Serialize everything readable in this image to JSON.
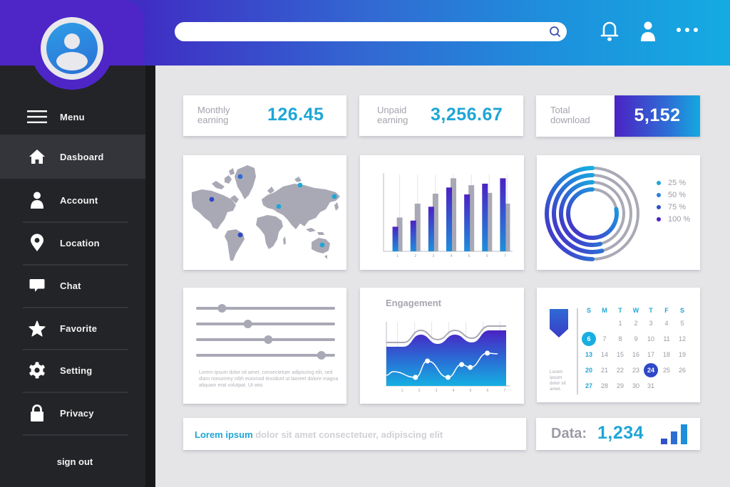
{
  "header": {
    "search": {
      "placeholder": "",
      "value": ""
    },
    "icons": [
      "bell-icon",
      "user-icon",
      "more-icon"
    ]
  },
  "sidebar": {
    "items": [
      {
        "label": "Menu",
        "icon": "menu-icon",
        "active": false
      },
      {
        "label": "Dasboard",
        "icon": "home-icon",
        "active": true
      },
      {
        "label": "Account",
        "icon": "user-icon",
        "active": false
      },
      {
        "label": "Location",
        "icon": "location-pin-icon",
        "active": false
      },
      {
        "label": "Chat",
        "icon": "chat-icon",
        "active": false
      },
      {
        "label": "Favorite",
        "icon": "star-icon",
        "active": false
      },
      {
        "label": "Setting",
        "icon": "gear-icon",
        "active": false
      },
      {
        "label": "Privacy",
        "icon": "lock-icon",
        "active": false
      }
    ],
    "sign_out": "sign out"
  },
  "stats": {
    "monthly": {
      "label_line1": "Monthly",
      "label_line2": "earning",
      "value": "126.45"
    },
    "unpaid": {
      "label_line1": "Unpaid",
      "label_line2": "earning",
      "value": "3,256.67"
    },
    "download": {
      "label_line1": "Total",
      "label_line2": "download",
      "value": "5,152"
    }
  },
  "sliders": {
    "values": [
      0.18,
      0.37,
      0.52,
      0.91
    ],
    "text": "Lorem ipsum dolor sit amet, consectetuer adipiscing elit, sed diam nonummy nibh euismod tincidunt ut laoreet dolore magna aliquam erat volutpat. Ut wisi"
  },
  "calendar": {
    "weekdays": [
      "S",
      "M",
      "T",
      "W",
      "T",
      "F",
      "S"
    ],
    "first_weekday_index": 2,
    "days_in_month": 31,
    "highlight_light": 6,
    "highlight_dark": 24,
    "note": "Lorem ipsum dolor sit amet."
  },
  "footer": {
    "highlight": "Lorem ipsum",
    "text": " dolor sit amet consectetuer, adipiscing elit",
    "data_label": "Data:",
    "data_value": "1,234"
  },
  "colors": {
    "accent": "#1ea6d6",
    "purple": "#4b22c4",
    "blue": "#2f6ad5",
    "gray": "#a9a9b6",
    "sidebar_bg": "#232427"
  },
  "chart_data": [
    {
      "type": "map",
      "title": "",
      "markers": [
        {
          "region": "Greenland",
          "color": "#2e6ad6"
        },
        {
          "region": "North America",
          "color": "#2e48c8"
        },
        {
          "region": "South America",
          "color": "#2e48c8"
        },
        {
          "region": "Europe",
          "color": "#1ea6d6"
        },
        {
          "region": "Northern Russia",
          "color": "#1ea6d6"
        },
        {
          "region": "Eastern Russia",
          "color": "#1ea6d6"
        },
        {
          "region": "Australia",
          "color": "#1ea6d6"
        }
      ]
    },
    {
      "type": "bar",
      "title": "",
      "categories": [
        "1",
        "2",
        "3",
        "4",
        "5",
        "6",
        "7"
      ],
      "series": [
        {
          "name": "primary",
          "values": [
            3.2,
            4.0,
            5.8,
            8.3,
            7.4,
            8.8,
            9.5
          ]
        },
        {
          "name": "secondary",
          "values": [
            4.4,
            6.2,
            7.5,
            9.5,
            8.6,
            7.6,
            6.2
          ]
        }
      ],
      "ylim": [
        0,
        10
      ],
      "grid": true
    },
    {
      "type": "pie",
      "title": "",
      "rings": [
        {
          "label": "25 %",
          "value": 25,
          "color": "#1ea6d6"
        },
        {
          "label": "50 %",
          "value": 50,
          "color": "#2a80d8"
        },
        {
          "label": "75 %",
          "value": 75,
          "color": "#2e52c8"
        },
        {
          "label": "100 %",
          "value": 100,
          "color": "#4b22c4"
        }
      ],
      "legend": "right"
    },
    {
      "type": "area",
      "title": "Engagement",
      "x": [
        0,
        1,
        2,
        3,
        4,
        5,
        6,
        7
      ],
      "categories": [
        "1",
        "2",
        "3",
        "4",
        "5",
        "6",
        "7"
      ],
      "series": [
        {
          "name": "area",
          "values": [
            5.5,
            5.5,
            7.2,
            5.9,
            7.2,
            6.1,
            7.8,
            7.8
          ]
        },
        {
          "name": "line",
          "x": [
            0.0,
            0.4,
            1.7,
            2.4,
            3.6,
            4.4,
            4.9,
            5.9,
            6.5
          ],
          "values": [
            1.5,
            2.0,
            1.2,
            3.5,
            1.2,
            3.0,
            2.6,
            4.6,
            4.5
          ]
        }
      ],
      "ylim": [
        0,
        9
      ],
      "grid": true
    }
  ]
}
